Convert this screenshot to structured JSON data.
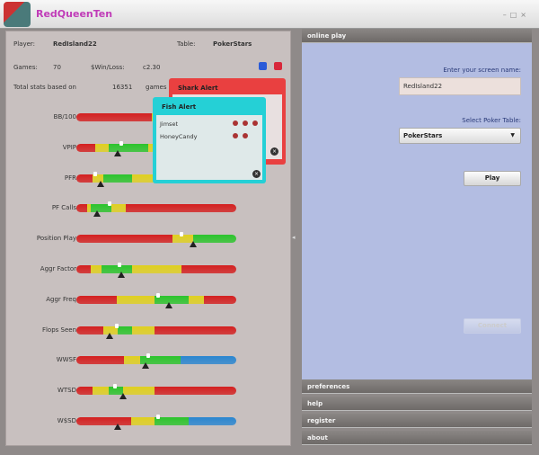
{
  "app": {
    "title": "RedQueenTen",
    "window_controls": [
      "–",
      "□",
      "×"
    ]
  },
  "stats": {
    "player_label": "Player:",
    "player": "RedIsland22",
    "table_label": "Table:",
    "table": "PokerStars",
    "games_label": "Games:",
    "games": "70",
    "winloss_label": "$Win/Loss:",
    "winloss": "c2.30",
    "total_label": "Total stats based on",
    "total_games": "16351",
    "total_suffix": "games",
    "rows": [
      {
        "label": "BB/100",
        "segments": [
          [
            "#d42020",
            0.47
          ],
          [
            "#e0d020",
            0.52
          ],
          [
            "#2cc42c",
            0.7
          ],
          [
            "#d42020",
            1
          ]
        ],
        "marker": null,
        "white": null
      },
      {
        "label": "VPIP",
        "segments": [
          [
            "#d42020",
            0.12
          ],
          [
            "#e0d020",
            0.2
          ],
          [
            "#2cc42c",
            0.45
          ],
          [
            "#e0d020",
            0.55
          ],
          [
            "#d42020",
            1
          ]
        ],
        "marker": 0.26,
        "white": 0.28
      },
      {
        "label": "PFR",
        "segments": [
          [
            "#d42020",
            0.1
          ],
          [
            "#e0d020",
            0.17
          ],
          [
            "#2cc42c",
            0.35
          ],
          [
            "#e0d020",
            0.55
          ],
          [
            "#d42020",
            1
          ]
        ],
        "marker": 0.15,
        "white": 0.12
      },
      {
        "label": "PF Calls",
        "segments": [
          [
            "#d42020",
            0.07
          ],
          [
            "#e0d020",
            0.09
          ],
          [
            "#2cc42c",
            0.22
          ],
          [
            "#e0d020",
            0.31
          ],
          [
            "#d42020",
            1
          ]
        ],
        "marker": 0.13,
        "white": 0.21
      },
      {
        "label": "Position Play",
        "segments": [
          [
            "#d42020",
            0.6
          ],
          [
            "#e0d020",
            0.73
          ],
          [
            "#2cc42c",
            1
          ]
        ],
        "marker": 0.73,
        "white": 0.66
      },
      {
        "label": "Aggr Factor",
        "segments": [
          [
            "#d42020",
            0.09
          ],
          [
            "#e0d020",
            0.16
          ],
          [
            "#2cc42c",
            0.35
          ],
          [
            "#e0d020",
            0.66
          ],
          [
            "#d42020",
            1
          ]
        ],
        "marker": 0.28,
        "white": 0.27
      },
      {
        "label": "Aggr Freq",
        "segments": [
          [
            "#d42020",
            0.25
          ],
          [
            "#e0d020",
            0.49
          ],
          [
            "#2cc42c",
            0.7
          ],
          [
            "#e0d020",
            0.8
          ],
          [
            "#d42020",
            1
          ]
        ],
        "marker": 0.58,
        "white": 0.51
      },
      {
        "label": "Flops Seen",
        "segments": [
          [
            "#d42020",
            0.17
          ],
          [
            "#e0d020",
            0.26
          ],
          [
            "#2cc42c",
            0.35
          ],
          [
            "#e0d020",
            0.49
          ],
          [
            "#d42020",
            1
          ]
        ],
        "marker": 0.21,
        "white": 0.25
      },
      {
        "label": "WWSF",
        "segments": [
          [
            "#d42020",
            0.3
          ],
          [
            "#e0d020",
            0.4
          ],
          [
            "#2cc42c",
            0.65
          ],
          [
            "#2a86d0",
            1
          ]
        ],
        "marker": 0.43,
        "white": 0.45
      },
      {
        "label": "WTSD",
        "segments": [
          [
            "#d42020",
            0.1
          ],
          [
            "#e0d020",
            0.2
          ],
          [
            "#2cc42c",
            0.29
          ],
          [
            "#e0d020",
            0.49
          ],
          [
            "#d42020",
            1
          ]
        ],
        "marker": 0.29,
        "white": 0.24
      },
      {
        "label": "W$SD",
        "segments": [
          [
            "#d42020",
            0.34
          ],
          [
            "#e0d020",
            0.49
          ],
          [
            "#2cc42c",
            0.7
          ],
          [
            "#2a86d0",
            1
          ]
        ],
        "marker": 0.26,
        "white": 0.51
      }
    ]
  },
  "shark_alert": {
    "title": "Shark Alert"
  },
  "fish_alert": {
    "title": "Fish Alert",
    "players": [
      {
        "name": "Jimset",
        "dots": 3
      },
      {
        "name": "HoneyCandy",
        "dots": 2
      }
    ]
  },
  "right": {
    "online_play": "online play",
    "screen_name_label": "Enter your screen name:",
    "screen_name": "RedIsland22",
    "table_label": "Select Poker Table:",
    "table_value": "PokerStars",
    "play": "Play",
    "connect": "Connect",
    "sections": [
      "preferences",
      "help",
      "register",
      "about"
    ]
  }
}
